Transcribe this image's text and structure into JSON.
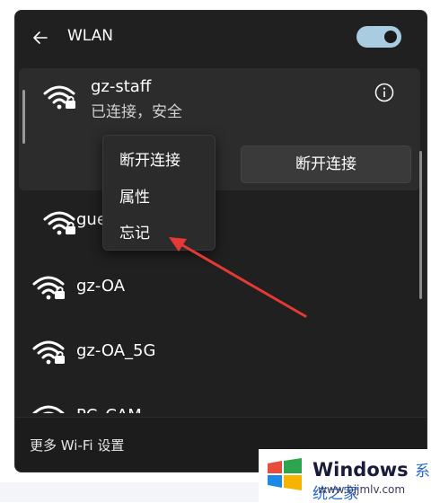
{
  "header": {
    "title": "WLAN",
    "back_icon": "arrow-left-icon",
    "toggle_state": "on"
  },
  "networks": [
    {
      "name": "gz-staff",
      "status": "已连接，安全",
      "icon": "wifi-secured-icon",
      "expanded": true
    },
    {
      "name": "gue",
      "icon": "wifi-secured-icon"
    },
    {
      "name": "gz-OA",
      "icon": "wifi-secured-icon"
    },
    {
      "name": "gz-OA_5G",
      "icon": "wifi-secured-icon"
    },
    {
      "name": "PC_CAM",
      "icon": "wifi-secured-icon"
    }
  ],
  "expanded_actions": {
    "disconnect_label": "断开连接",
    "info_icon": "info-icon"
  },
  "context_menu": {
    "items": [
      {
        "label": "断开连接"
      },
      {
        "label": "属性"
      },
      {
        "label": "忘记"
      }
    ]
  },
  "footer": {
    "link_label": "更多 Wi-Fi 设置"
  },
  "watermark": {
    "brand": "Windows",
    "brand_cn": "系统之家",
    "url": "www.bjjmlv.com"
  },
  "colors": {
    "panel_bg": "#202020",
    "toggle_on": "#a9cce0",
    "arrow": "#e53935"
  }
}
